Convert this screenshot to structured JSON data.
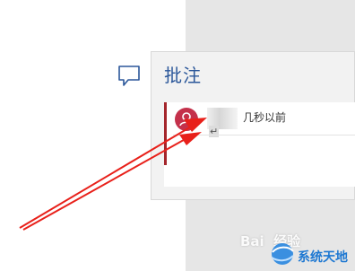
{
  "pane": {
    "title": "批注"
  },
  "comment": {
    "timestamp": "几秒以前",
    "paragraph_mark": "↵"
  },
  "watermarks": {
    "baidu": "Bai  经验",
    "site": "系统天地"
  },
  "colors": {
    "title_blue": "#2b579a",
    "accent_red": "#a4262c",
    "avatar_red": "#c4314b",
    "arrow_red": "#e8201a"
  },
  "icons": {
    "comment_trigger": "speech-bubble-icon",
    "avatar": "user-avatar-icon",
    "annotation": "red-arrow"
  }
}
